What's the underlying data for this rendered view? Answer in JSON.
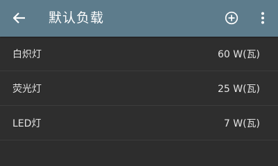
{
  "header": {
    "title": "默认负载",
    "back_icon": "arrow-left-icon",
    "add_icon": "plus-circle-icon",
    "more_icon": "more-vertical-icon",
    "background_color": "#5d7c8c"
  },
  "loads": [
    {
      "label": "白炽灯",
      "value": "60 W(瓦)"
    },
    {
      "label": "荧光灯",
      "value": "25 W(瓦)"
    },
    {
      "label": "LED灯",
      "value": "7 W(瓦)"
    }
  ]
}
